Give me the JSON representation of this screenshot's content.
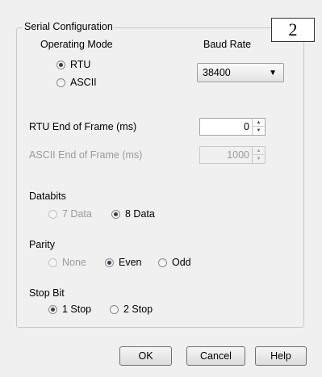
{
  "group": {
    "title": "Serial Configuration"
  },
  "callout": "2",
  "operating_mode": {
    "label": "Operating Mode",
    "options": [
      {
        "label": "RTU",
        "checked": true
      },
      {
        "label": "ASCII",
        "checked": false
      }
    ]
  },
  "baud_rate": {
    "label": "Baud Rate",
    "value": "38400"
  },
  "rtu_eof": {
    "label": "RTU End of Frame (ms)",
    "value": "0"
  },
  "ascii_eof": {
    "label": "ASCII End of Frame (ms)",
    "value": "1000",
    "enabled": false
  },
  "databits": {
    "label": "Databits",
    "options": [
      {
        "label": "7 Data",
        "checked": false,
        "enabled": false
      },
      {
        "label": "8 Data",
        "checked": true,
        "enabled": true
      }
    ]
  },
  "parity": {
    "label": "Parity",
    "options": [
      {
        "label": "None",
        "checked": false,
        "enabled": false
      },
      {
        "label": "Even",
        "checked": true,
        "enabled": true
      },
      {
        "label": "Odd",
        "checked": false,
        "enabled": true
      }
    ]
  },
  "stop_bit": {
    "label": "Stop Bit",
    "options": [
      {
        "label": "1 Stop",
        "checked": true,
        "enabled": true
      },
      {
        "label": "2 Stop",
        "checked": false,
        "enabled": true
      }
    ]
  },
  "buttons": {
    "ok": "OK",
    "cancel": "Cancel",
    "help": "Help"
  }
}
